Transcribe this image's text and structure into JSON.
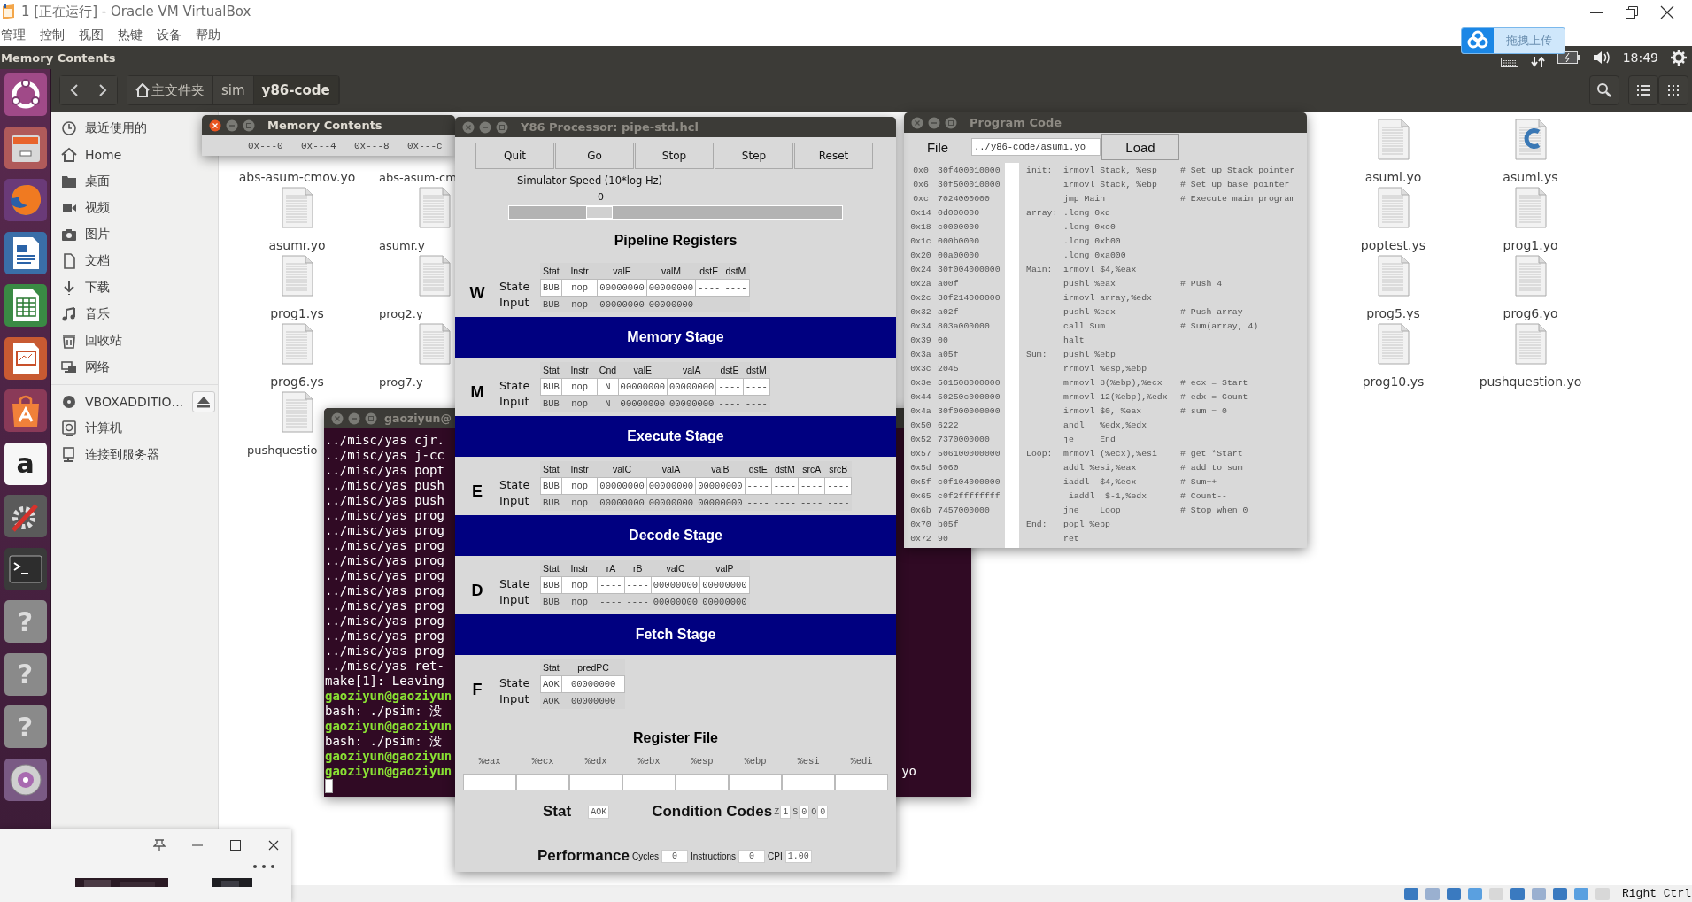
{
  "host_window": {
    "title": "1 [正在运行] - Oracle VM VirtualBox",
    "menu": [
      "管理",
      "控制",
      "视图",
      "热键",
      "设备",
      "帮助"
    ]
  },
  "upload_float": {
    "label": "拖拽上传"
  },
  "top_panel": {
    "app_title": "Memory Contents",
    "clock": "18:49"
  },
  "launcher": [
    {
      "kind": "dash"
    },
    {
      "kind": "files"
    },
    {
      "kind": "browser"
    },
    {
      "kind": "writer"
    },
    {
      "kind": "calc"
    },
    {
      "kind": "impress"
    },
    {
      "kind": "store"
    },
    {
      "kind": "amazon",
      "glyph": "a"
    },
    {
      "kind": "settings"
    },
    {
      "kind": "terminal"
    },
    {
      "kind": "help",
      "glyph": "?"
    },
    {
      "kind": "help",
      "glyph": "?"
    },
    {
      "kind": "help",
      "glyph": "?"
    },
    {
      "kind": "disc"
    }
  ],
  "file_manager": {
    "breadcrumb": [
      {
        "kind": "home",
        "label": "主文件夹",
        "selected": false
      },
      {
        "kind": "folder",
        "label": "sim",
        "selected": false
      },
      {
        "kind": "folder",
        "label": "y86-code",
        "selected": true
      }
    ],
    "places": [
      {
        "kind": "recent",
        "label": "最近使用的"
      },
      {
        "kind": "home",
        "label": "Home"
      },
      {
        "kind": "folder",
        "label": "桌面"
      },
      {
        "kind": "video",
        "label": "视频"
      },
      {
        "kind": "camera",
        "label": "图片"
      },
      {
        "kind": "document",
        "label": "文档"
      },
      {
        "kind": "download",
        "label": "下载"
      },
      {
        "kind": "music",
        "label": "音乐"
      },
      {
        "kind": "trash",
        "label": "回收站"
      },
      {
        "kind": "network",
        "label": "网络"
      }
    ],
    "devices": [
      {
        "kind": "disc",
        "label": "VBOXADDITIO…",
        "eject": true
      },
      {
        "kind": "computer",
        "label": "计算机",
        "eject": false
      },
      {
        "kind": "server",
        "label": "连接到服务器",
        "eject": false
      }
    ],
    "files_left": [
      {
        "name": "abs-asum-cmov.yo"
      },
      {
        "name": "abs-asum-cm"
      },
      {
        "kind": "text",
        "name": "asumr.yo"
      },
      {
        "kind": "text",
        "name": "asumr.y"
      },
      {
        "kind": "text",
        "name": "prog1.ys"
      },
      {
        "kind": "text",
        "name": "prog2.y"
      },
      {
        "kind": "text",
        "name": "prog6.ys"
      },
      {
        "kind": "text",
        "name": "prog7.y"
      },
      {
        "kind": "text",
        "name": "pushquestio"
      }
    ],
    "files_right": [
      {
        "kind": "text",
        "name": "asuml.yo"
      },
      {
        "kind": "source",
        "name": "asuml.ys"
      },
      {
        "kind": "text",
        "name": "poptest.ys"
      },
      {
        "kind": "text",
        "name": "prog1.yo"
      },
      {
        "kind": "text",
        "name": "prog5.ys"
      },
      {
        "kind": "text",
        "name": "prog6.yo"
      },
      {
        "kind": "text",
        "name": "prog10.ys"
      },
      {
        "kind": "text",
        "name": "pushquestion.yo"
      }
    ]
  },
  "memory_window": {
    "title": "Memory Contents",
    "columns": [
      "0x---0",
      "0x---4",
      "0x---8",
      "0x---c"
    ]
  },
  "terminal": {
    "title": "gaoziyun@",
    "cursor": true,
    "lines": [
      {
        "kind": "output",
        "text": "../misc/yas cjr."
      },
      {
        "kind": "output",
        "text": "../misc/yas j-cc"
      },
      {
        "kind": "output",
        "text": "../misc/yas popt"
      },
      {
        "kind": "output",
        "text": "../misc/yas push"
      },
      {
        "kind": "output",
        "text": "../misc/yas push"
      },
      {
        "kind": "output",
        "text": "../misc/yas prog"
      },
      {
        "kind": "output",
        "text": "../misc/yas prog"
      },
      {
        "kind": "output",
        "text": "../misc/yas prog"
      },
      {
        "kind": "output",
        "text": "../misc/yas prog"
      },
      {
        "kind": "output",
        "text": "../misc/yas prog"
      },
      {
        "kind": "output",
        "text": "../misc/yas prog"
      },
      {
        "kind": "output",
        "text": "../misc/yas prog"
      },
      {
        "kind": "output",
        "text": "../misc/yas prog"
      },
      {
        "kind": "output",
        "text": "../misc/yas prog"
      },
      {
        "kind": "output",
        "text": "../misc/yas prog"
      },
      {
        "kind": "output",
        "text": "../misc/yas ret-"
      },
      {
        "kind": "output",
        "text": "make[1]: Leaving"
      },
      {
        "kind": "prompt",
        "text": "gaoziyun@gaoziyun"
      },
      {
        "kind": "output",
        "text": "bash: ./psim: 没"
      },
      {
        "kind": "prompt",
        "text": "gaoziyun@gaoziyun"
      },
      {
        "kind": "output",
        "text": "bash: ./psim: 没"
      },
      {
        "kind": "prompt",
        "text": "gaoziyun@gaoziyun"
      },
      {
        "kind": "prompt",
        "text": "gaoziyun@gaoziyun",
        "tail": "yo"
      }
    ]
  },
  "processor": {
    "title": "Y86 Processor: pipe-std.hcl",
    "buttons": [
      "Quit",
      "Go",
      "Stop",
      "Step",
      "Reset"
    ],
    "speed": {
      "label": "Simulator Speed (10*log Hz)",
      "reading": "0",
      "level": 0.25
    },
    "pipeline_title": "Pipeline Registers",
    "stages": [
      {
        "letter": "W",
        "row_labels": [
          "State",
          "Input"
        ],
        "columns": [
          "Stat",
          "Instr",
          "valE",
          "valM",
          "dstE",
          "dstM"
        ],
        "state": [
          "BUB",
          "nop",
          "00000000",
          "00000000",
          "----",
          "----"
        ],
        "input": [
          "BUB",
          "nop",
          "00000000",
          "00000000",
          "----",
          "----"
        ]
      },
      {
        "band": "Memory Stage",
        "letter": "M",
        "row_labels": [
          "State",
          "Input"
        ],
        "columns": [
          "Stat",
          "Instr",
          "Cnd",
          "valE",
          "valA",
          "dstE",
          "dstM"
        ],
        "state": [
          "BUB",
          "nop",
          "N",
          "00000000",
          "00000000",
          "----",
          "----"
        ],
        "input": [
          "BUB",
          "nop",
          "N",
          "00000000",
          "00000000",
          "----",
          "----"
        ]
      },
      {
        "band": "Execute Stage",
        "letter": "E",
        "row_labels": [
          "State",
          "Input"
        ],
        "columns": [
          "Stat",
          "Instr",
          "valC",
          "valA",
          "valB",
          "dstE",
          "dstM",
          "srcA",
          "srcB"
        ],
        "state": [
          "BUB",
          "nop",
          "00000000",
          "00000000",
          "00000000",
          "----",
          "----",
          "----",
          "----"
        ],
        "input": [
          "BUB",
          "nop",
          "00000000",
          "00000000",
          "00000000",
          "----",
          "----",
          "----",
          "----"
        ]
      },
      {
        "band": "Decode Stage",
        "letter": "D",
        "row_labels": [
          "State",
          "Input"
        ],
        "columns": [
          "Stat",
          "Instr",
          "rA",
          "rB",
          "valC",
          "valP"
        ],
        "state": [
          "BUB",
          "nop",
          "----",
          "----",
          "00000000",
          "00000000"
        ],
        "input": [
          "BUB",
          "nop",
          "----",
          "----",
          "00000000",
          "00000000"
        ]
      },
      {
        "band": "Fetch Stage",
        "letter": "F",
        "row_labels": [
          "State",
          "Input"
        ],
        "columns": [
          "Stat",
          "predPC"
        ],
        "state": [
          "AOK",
          "00000000"
        ],
        "input": [
          "AOK",
          "00000000"
        ]
      }
    ],
    "register_file": {
      "title": "Register File",
      "registers": [
        "%eax",
        "%ecx",
        "%edx",
        "%ebx",
        "%esp",
        "%ebp",
        "%esi",
        "%edi"
      ]
    },
    "status": {
      "label": "Stat",
      "value": "AOK"
    },
    "condition_codes": {
      "label": "Condition Codes",
      "flags": [
        {
          "name": "Z",
          "value": "1"
        },
        {
          "name": "S",
          "value": "0"
        },
        {
          "name": "O",
          "value": "0"
        }
      ]
    },
    "performance": {
      "label": "Performance",
      "counters": [
        {
          "name": "Cycles",
          "value": "0"
        },
        {
          "name": "Instructions",
          "value": "0"
        },
        {
          "name": "CPI",
          "value": "1.00"
        }
      ]
    }
  },
  "program_code": {
    "title": "Program Code",
    "file_label": "File",
    "file_path": "../y86-code/asumi.yo",
    "load_button": "Load",
    "lines": [
      {
        "addr": "0x0",
        "bytes": "30f400010000",
        "label": "init:",
        "code": "irmovl Stack, %esp",
        "comment": "# Set up Stack pointer"
      },
      {
        "addr": "0x6",
        "bytes": "30f500010000",
        "code": "irmovl Stack, %ebp",
        "comment": "# Set up base pointer"
      },
      {
        "addr": "0xc",
        "bytes": "7024000000",
        "code": "jmp Main",
        "comment": "# Execute main program"
      },
      {
        "addr": "0x14",
        "bytes": "0d000000",
        "label": "array:",
        "code": ".long 0xd"
      },
      {
        "addr": "0x18",
        "bytes": "c0000000",
        "code": ".long 0xc0"
      },
      {
        "addr": "0x1c",
        "bytes": "000b0000",
        "code": ".long 0xb00"
      },
      {
        "addr": "0x20",
        "bytes": "00a00000",
        "code": ".long 0xa000"
      },
      {
        "addr": "0x24",
        "bytes": "30f004000000",
        "label": "Main:",
        "code": "irmovl $4,%eax"
      },
      {
        "addr": "0x2a",
        "bytes": "a00f",
        "code": "pushl %eax",
        "comment": "# Push 4"
      },
      {
        "addr": "0x2c",
        "bytes": "30f214000000",
        "code": "irmovl array,%edx"
      },
      {
        "addr": "0x32",
        "bytes": "a02f",
        "code": "pushl %edx",
        "comment": "# Push array"
      },
      {
        "addr": "0x34",
        "bytes": "803a000000",
        "code": "call Sum",
        "comment": "# Sum(array, 4)"
      },
      {
        "addr": "0x39",
        "bytes": "00",
        "code": "halt"
      },
      {
        "addr": "0x3a",
        "bytes": "a05f",
        "label": "Sum:",
        "code": "pushl %ebp"
      },
      {
        "addr": "0x3c",
        "bytes": "2045",
        "code": "rrmovl %esp,%ebp"
      },
      {
        "addr": "0x3e",
        "bytes": "501508000000",
        "code": "mrmovl 8(%ebp),%ecx",
        "comment": "# ecx = Start"
      },
      {
        "addr": "0x44",
        "bytes": "50250c000000",
        "code": "mrmovl 12(%ebp),%edx",
        "comment": "# edx = Count"
      },
      {
        "addr": "0x4a",
        "bytes": "30f000000000",
        "code": "irmovl $0, %eax",
        "comment": "# sum = 0"
      },
      {
        "addr": "0x50",
        "bytes": "6222",
        "code": "andl   %edx,%edx"
      },
      {
        "addr": "0x52",
        "bytes": "7370000000",
        "code": "je     End"
      },
      {
        "addr": "0x57",
        "bytes": "506100000000",
        "label": "Loop:",
        "code": "mrmovl (%ecx),%esi",
        "comment": "# get *Start"
      },
      {
        "addr": "0x5d",
        "bytes": "6060",
        "code": "addl %esi,%eax",
        "comment": "# add to sum"
      },
      {
        "addr": "0x5f",
        "bytes": "c0f104000000",
        "code": "iaddl  $4,%ecx",
        "comment": "# Sum++"
      },
      {
        "addr": "0x65",
        "bytes": "c0f2ffffffff",
        "code": " iaddl  $-1,%edx",
        "comment": "# Count--"
      },
      {
        "addr": "0x6b",
        "bytes": "7457000000",
        "code": "jne    Loop",
        "comment": "# Stop when 0"
      },
      {
        "addr": "0x70",
        "bytes": "b05f",
        "label": "End:",
        "code": "popl %ebp"
      },
      {
        "addr": "0x72",
        "bytes": "90",
        "code": "ret"
      }
    ]
  },
  "host_status": {
    "host_key": "Right Ctrl"
  }
}
